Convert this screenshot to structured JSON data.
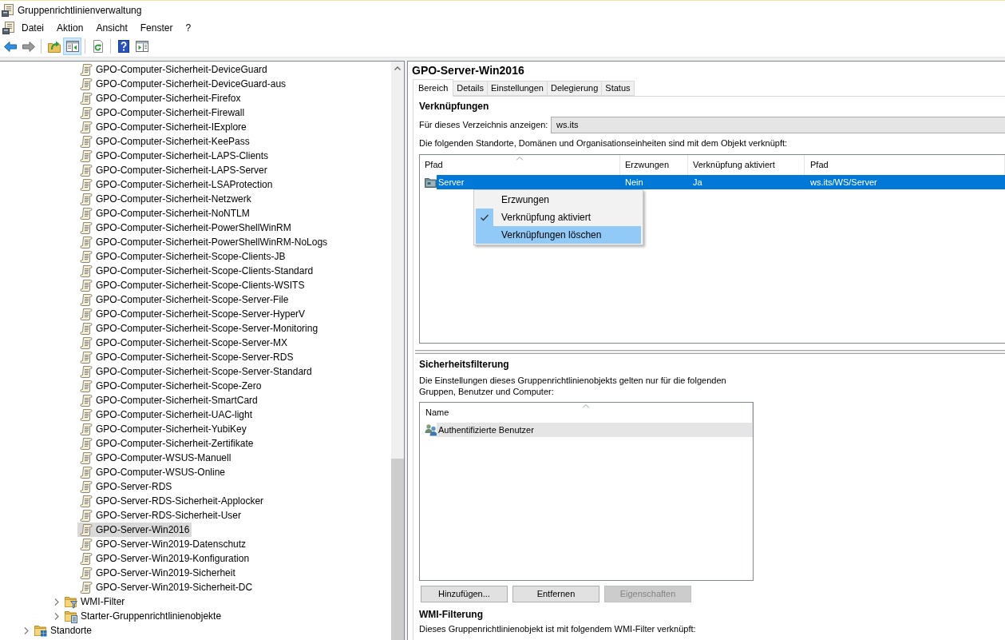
{
  "window": {
    "title": "Gruppenrichtlinienverwaltung"
  },
  "menu_bar": [
    "Datei",
    "Aktion",
    "Ansicht",
    "Fenster",
    "?"
  ],
  "toolbar": {
    "groups": [
      [
        {
          "kind": "back",
          "disabled": false,
          "pressed": false
        },
        {
          "kind": "forward",
          "disabled": true,
          "pressed": false
        }
      ],
      [
        {
          "kind": "up-folder",
          "disabled": false,
          "pressed": false
        },
        {
          "kind": "console-tree",
          "disabled": false,
          "pressed": true
        }
      ],
      [
        {
          "kind": "refresh",
          "disabled": false,
          "pressed": false
        }
      ],
      [
        {
          "kind": "help",
          "disabled": false,
          "pressed": false
        },
        {
          "kind": "action-pane",
          "disabled": false,
          "pressed": false
        }
      ]
    ]
  },
  "tree": {
    "items": [
      {
        "children": [
          {
            "children": [
              {
                "children": [
                  {
                    "label": "GPO-Computer-Sicherheit-DeviceGuard",
                    "kind": "gpo",
                    "selected": false
                  },
                  {
                    "label": "GPO-Computer-Sicherheit-DeviceGuard-aus",
                    "kind": "gpo",
                    "selected": false
                  },
                  {
                    "label": "GPO-Computer-Sicherheit-Firefox",
                    "kind": "gpo",
                    "selected": false
                  },
                  {
                    "label": "GPO-Computer-Sicherheit-Firewall",
                    "kind": "gpo",
                    "selected": false
                  },
                  {
                    "label": "GPO-Computer-Sicherheit-IExplore",
                    "kind": "gpo",
                    "selected": false
                  },
                  {
                    "label": "GPO-Computer-Sicherheit-KeePass",
                    "kind": "gpo",
                    "selected": false
                  },
                  {
                    "label": "GPO-Computer-Sicherheit-LAPS-Clients",
                    "kind": "gpo",
                    "selected": false
                  },
                  {
                    "label": "GPO-Computer-Sicherheit-LAPS-Server",
                    "kind": "gpo",
                    "selected": false
                  },
                  {
                    "label": "GPO-Computer-Sicherheit-LSAProtection",
                    "kind": "gpo",
                    "selected": false
                  },
                  {
                    "label": "GPO-Computer-Sicherheit-Netzwerk",
                    "kind": "gpo",
                    "selected": false
                  },
                  {
                    "label": "GPO-Computer-Sicherheit-NoNTLM",
                    "kind": "gpo",
                    "selected": false
                  },
                  {
                    "label": "GPO-Computer-Sicherheit-PowerShellWinRM",
                    "kind": "gpo",
                    "selected": false
                  },
                  {
                    "label": "GPO-Computer-Sicherheit-PowerShellWinRM-NoLogs",
                    "kind": "gpo",
                    "selected": false
                  },
                  {
                    "label": "GPO-Computer-Sicherheit-Scope-Clients-JB",
                    "kind": "gpo",
                    "selected": false
                  },
                  {
                    "label": "GPO-Computer-Sicherheit-Scope-Clients-Standard",
                    "kind": "gpo",
                    "selected": false
                  },
                  {
                    "label": "GPO-Computer-Sicherheit-Scope-Clients-WSITS",
                    "kind": "gpo",
                    "selected": false
                  },
                  {
                    "label": "GPO-Computer-Sicherheit-Scope-Server-File",
                    "kind": "gpo",
                    "selected": false
                  },
                  {
                    "label": "GPO-Computer-Sicherheit-Scope-Server-HyperV",
                    "kind": "gpo",
                    "selected": false
                  },
                  {
                    "label": "GPO-Computer-Sicherheit-Scope-Server-Monitoring",
                    "kind": "gpo",
                    "selected": false
                  },
                  {
                    "label": "GPO-Computer-Sicherheit-Scope-Server-MX",
                    "kind": "gpo",
                    "selected": false
                  },
                  {
                    "label": "GPO-Computer-Sicherheit-Scope-Server-RDS",
                    "kind": "gpo",
                    "selected": false
                  },
                  {
                    "label": "GPO-Computer-Sicherheit-Scope-Server-Standard",
                    "kind": "gpo",
                    "selected": false
                  },
                  {
                    "label": "GPO-Computer-Sicherheit-Scope-Zero",
                    "kind": "gpo",
                    "selected": false
                  },
                  {
                    "label": "GPO-Computer-Sicherheit-SmartCard",
                    "kind": "gpo",
                    "selected": false
                  },
                  {
                    "label": "GPO-Computer-Sicherheit-UAC-light",
                    "kind": "gpo",
                    "selected": false
                  },
                  {
                    "label": "GPO-Computer-Sicherheit-YubiKey",
                    "kind": "gpo",
                    "selected": false
                  },
                  {
                    "label": "GPO-Computer-Sicherheit-Zertifikate",
                    "kind": "gpo",
                    "selected": false
                  },
                  {
                    "label": "GPO-Computer-WSUS-Manuell",
                    "kind": "gpo",
                    "selected": false
                  },
                  {
                    "label": "GPO-Computer-WSUS-Online",
                    "kind": "gpo",
                    "selected": false
                  },
                  {
                    "label": "GPO-Server-RDS",
                    "kind": "gpo",
                    "selected": false
                  },
                  {
                    "label": "GPO-Server-RDS-Sicherheit-Applocker",
                    "kind": "gpo",
                    "selected": false
                  },
                  {
                    "label": "GPO-Server-RDS-Sicherheit-User",
                    "kind": "gpo",
                    "selected": false
                  },
                  {
                    "label": "GPO-Server-Win2016",
                    "kind": "gpo",
                    "selected": true
                  },
                  {
                    "label": "GPO-Server-Win2019-Datenschutz",
                    "kind": "gpo",
                    "selected": false
                  },
                  {
                    "label": "GPO-Server-Win2019-Konfiguration",
                    "kind": "gpo",
                    "selected": false
                  },
                  {
                    "label": "GPO-Server-Win2019-Sicherheit",
                    "kind": "gpo",
                    "selected": false
                  },
                  {
                    "label": "GPO-Server-Win2019-Sicherheit-DC",
                    "kind": "gpo",
                    "selected": false
                  }
                ]
              },
              {
                "label": "WMI-Filter",
                "kind": "wmi-filters",
                "selected": false,
                "expanded": false
              },
              {
                "label": "Starter-Gruppenrichtlinienobjekte",
                "kind": "starter-gpos",
                "selected": false,
                "expanded": false
              }
            ]
          }
        ]
      },
      {
        "label": "Standorte",
        "kind": "sites",
        "selected": false,
        "expanded": false
      }
    ]
  },
  "details": {
    "title": "GPO-Server-Win2016",
    "tabs": [
      {
        "label": "Bereich",
        "selected": true
      },
      {
        "label": "Details",
        "selected": false
      },
      {
        "label": "Einstellungen",
        "selected": false
      },
      {
        "label": "Delegierung",
        "selected": false
      },
      {
        "label": "Status",
        "selected": false
      }
    ],
    "links": {
      "heading": "Verknüpfungen",
      "location_label": "Für dieses Verzeichnis anzeigen:",
      "location": {
        "value": "ws.its"
      },
      "description": "Die folgenden Standorte, Domänen und Organisationseinheiten sind mit dem Objekt verknüpft:",
      "table": {
        "focused": true,
        "columns": [
          {
            "label": "Pfad",
            "sorted": true
          },
          {
            "label": "Erzwungen",
            "sorted": false
          },
          {
            "label": "Verknüpfung aktiviert",
            "sorted": false
          },
          {
            "label": "Pfad",
            "sorted": false
          }
        ],
        "rows": [
          {
            "kind": "ou",
            "selected": true,
            "cells": [
              "Server",
              "Nein",
              "Ja",
              "ws.its/WS/Server"
            ]
          }
        ]
      },
      "context_menu": {
        "items": [
          {
            "label": "Erzwungen",
            "checked": false,
            "highlighted": false
          },
          {
            "label": "Verknüpfung aktiviert",
            "checked": true,
            "highlighted": false
          },
          {
            "label": "Verknüpfungen löschen",
            "checked": false,
            "highlighted": true
          }
        ]
      }
    },
    "security_filtering": {
      "heading": "Sicherheitsfilterung",
      "description": "Die Einstellungen dieses Gruppenrichtlinienobjekts gelten nur für die folgenden Gruppen, Benutzer und Computer:",
      "table": {
        "focused": false,
        "columns": [
          {
            "label": "Name",
            "sorted": true
          }
        ],
        "rows": [
          {
            "kind": "group",
            "selected": true,
            "cells": [
              "Authentifizierte Benutzer"
            ]
          }
        ]
      },
      "buttons": [
        {
          "label": "Hinzufügen...",
          "disabled": false
        },
        {
          "label": "Entfernen",
          "disabled": false
        },
        {
          "label": "Eigenschaften",
          "disabled": true
        }
      ]
    },
    "wmi_filtering": {
      "heading": "WMI-Filterung",
      "description": "Dieses Gruppenrichtlinienobjekt ist mit folgendem WMI-Filter verknüpft:"
    }
  }
}
